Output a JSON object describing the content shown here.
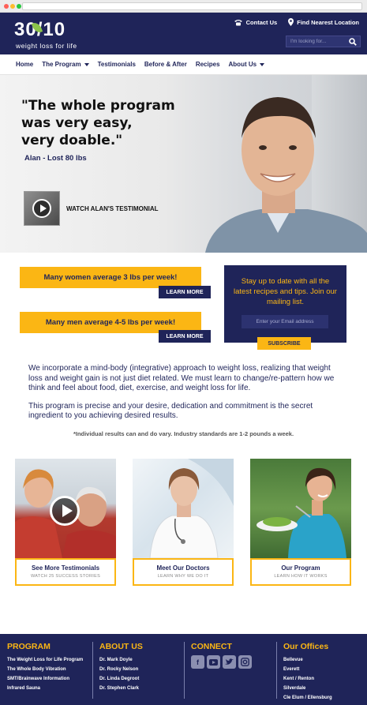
{
  "header": {
    "logo_main": "30/10",
    "logo_sub": "weight loss for life",
    "contact_label": "Contact Us",
    "location_label": "Find Nearest Location",
    "search_placeholder": "I'm looking for..."
  },
  "nav": {
    "items": [
      {
        "label": "Home"
      },
      {
        "label": "The Program"
      },
      {
        "label": "Testimonials"
      },
      {
        "label": "Before & After"
      },
      {
        "label": "Recipes"
      },
      {
        "label": "About Us"
      }
    ]
  },
  "hero": {
    "quote_line1": "\"The whole program",
    "quote_line2": "was very easy,",
    "quote_line3": "very doable.\"",
    "name": "Alan",
    "result": "Lost 80 lbs",
    "testimonial_label": "WATCH ALAN'S TESTIMONIAL"
  },
  "promo": {
    "stat_women": "Many women average 3 lbs per week!",
    "stat_men": "Many men average 4-5 lbs per week!",
    "learn_more": "LEARN MORE",
    "newsletter_text": "Stay up to date with all the latest recipes and tips. Join our mailing list.",
    "email_placeholder": "Enter your Email address",
    "subscribe": "SUBSCRIBE"
  },
  "copy": {
    "para1": "We incorporate a mind-body (integrative) approach to weight loss, realizing that weight loss and weight gain is not just diet related. We must learn to change/re-pattern how we think and feel about food, diet, exercise, and weight loss for life.",
    "para2": "This program is precise and your desire, dedication and commitment is the secret ingredient to you achieving desired results.",
    "disclaimer": "*Individual results can and do vary. Industry standards are 1-2 pounds a week."
  },
  "cards": [
    {
      "title": "See More Testimonials",
      "subtitle": "WATCH 25 SUCCESS STORIES"
    },
    {
      "title": "Meet Our Doctors",
      "subtitle": "LEARN WHY WE DO IT"
    },
    {
      "title": "Our Program",
      "subtitle": "LEARN HOW IT WORKS"
    }
  ],
  "footer": {
    "program": {
      "heading": "PROGRAM",
      "links": [
        "The Weight Loss for Life Program",
        "The Whole Body Vibration",
        "SMT/Brainwave Information",
        "Infrared Sauna"
      ]
    },
    "about": {
      "heading": "ABOUT US",
      "links": [
        "Dr. Mark Doyle",
        "Dr. Rocky Nelson",
        "Dr. Linda Degroot",
        "Dr. Stephen Clark"
      ]
    },
    "connect": {
      "heading": "CONNECT",
      "icons": [
        "facebook-icon",
        "youtube-icon",
        "twitter-icon",
        "instagram-icon"
      ]
    },
    "offices": {
      "heading": "Our Offices",
      "links": [
        "Bellevue",
        "Everett",
        "Kent / Renton",
        "Silverdale",
        "Cle Elum / Ellensburg"
      ]
    }
  },
  "colors": {
    "navy": "#1f2459",
    "gold": "#fbb614",
    "green_leaf": "#8bc34a"
  }
}
